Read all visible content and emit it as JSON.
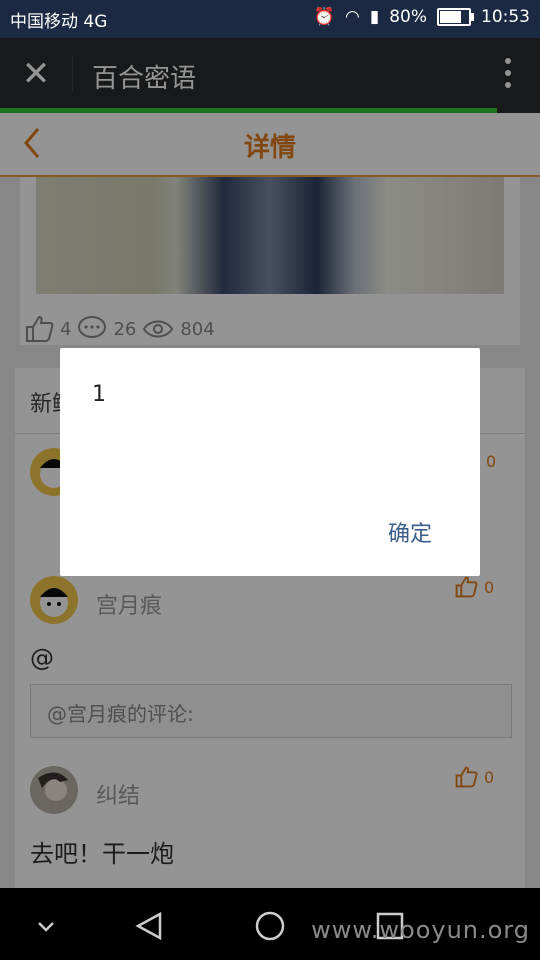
{
  "status_bar": {
    "carrier": "中国移动 4G",
    "battery": "80%",
    "battery_level": 0.8,
    "time": "10:53"
  },
  "wechat": {
    "close_icon": "close-icon",
    "title": "百合密语",
    "more_icon": "more-vertical-icon",
    "load_progress": 0.92
  },
  "page": {
    "nav_title": "详情",
    "back_icon": "chevron-left-icon"
  },
  "post_stats": {
    "likes": "4",
    "comments": "26",
    "views": "804"
  },
  "comments_section": {
    "label_partial": "新鲜"
  },
  "comments": [
    {
      "name": "",
      "likes": "0",
      "text": ""
    },
    {
      "name": "宫月痕",
      "likes": "0",
      "text": "@",
      "quote": "@宫月痕的评论:"
    },
    {
      "name": "纠结",
      "likes": "0",
      "text": "去吧！干一炮"
    }
  ],
  "dialog": {
    "message": "1",
    "ok_label": "确定"
  },
  "android_nav": {
    "watermark": "www.wooyun.org"
  },
  "colors": {
    "accent_orange": "#e07a1b",
    "wechat_dark": "#2a2c2d",
    "progress_green": "#37c837",
    "dialog_button": "#3b5d8a"
  }
}
